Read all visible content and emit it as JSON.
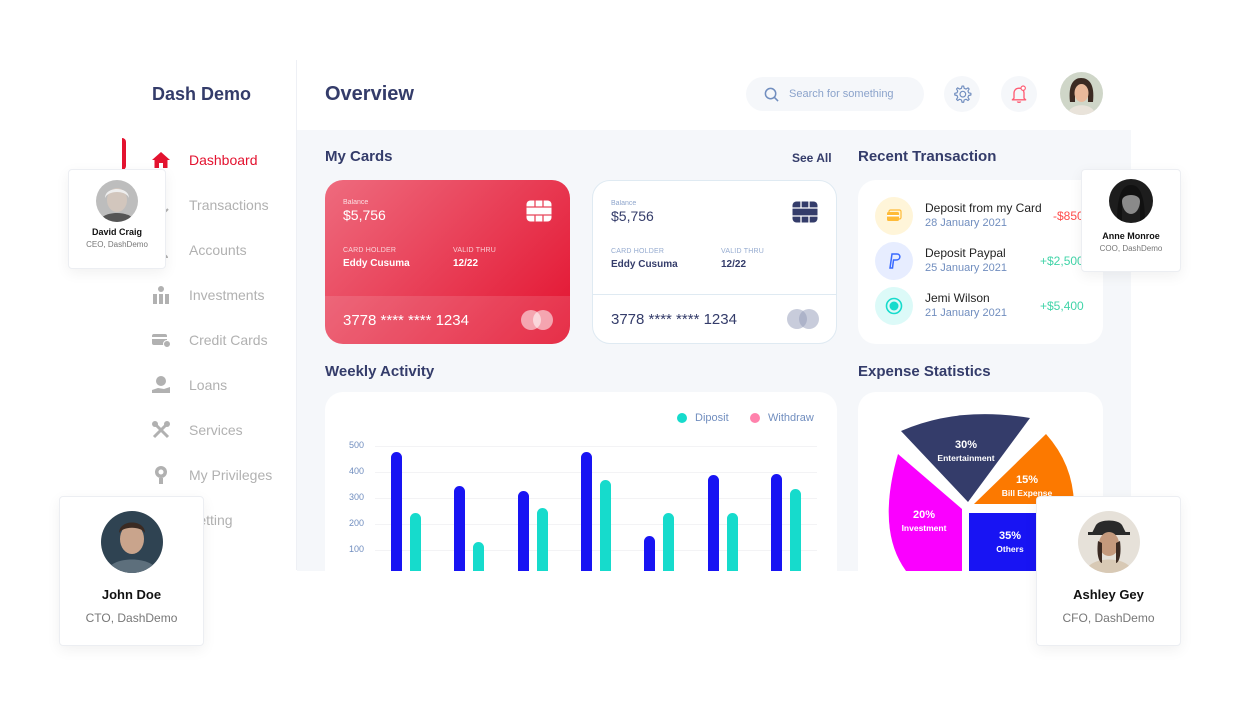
{
  "brand": "Dash Demo",
  "header": {
    "title": "Overview",
    "search_placeholder": "Search for something"
  },
  "sidebar": {
    "items": [
      {
        "label": "Dashboard",
        "icon": "home-icon",
        "active": true
      },
      {
        "label": "Transactions",
        "icon": "transfer-icon"
      },
      {
        "label": "Accounts",
        "icon": "user-icon"
      },
      {
        "label": "Investments",
        "icon": "investment-icon"
      },
      {
        "label": "Credit Cards",
        "icon": "credit-card-icon"
      },
      {
        "label": "Loans",
        "icon": "loan-icon"
      },
      {
        "label": "Services",
        "icon": "services-icon"
      },
      {
        "label": "My Privileges",
        "icon": "privileges-icon"
      },
      {
        "label": "Setting",
        "icon": "settings-icon"
      }
    ]
  },
  "my_cards": {
    "title": "My Cards",
    "see_all": "See All",
    "cards": [
      {
        "balance_label": "Balance",
        "balance": "$5,756",
        "holder_label": "CARD HOLDER",
        "holder": "Eddy Cusuma",
        "valid_label": "VALID THRU",
        "valid": "12/22",
        "number": "3778 **** **** 1234"
      },
      {
        "balance_label": "Balance",
        "balance": "$5,756",
        "holder_label": "CARD HOLDER",
        "holder": "Eddy Cusuma",
        "valid_label": "VALID THRU",
        "valid": "12/22",
        "number": "3778 **** **** 1234"
      }
    ]
  },
  "recent_transaction": {
    "title": "Recent Transaction",
    "items": [
      {
        "name": "Deposit from my Card",
        "date": "28 January 2021",
        "amount": "-$850",
        "icon": "card-icon",
        "amount_color": "#FF4B4A"
      },
      {
        "name": "Deposit Paypal",
        "date": "25 January 2021",
        "amount": "+$2,500",
        "icon": "paypal-icon",
        "amount_color": "#41D4A8"
      },
      {
        "name": "Jemi Wilson",
        "date": "21 January 2021",
        "amount": "+$5,400",
        "icon": "coin-icon",
        "amount_color": "#41D4A8"
      }
    ]
  },
  "weekly_activity": {
    "title": "Weekly Activity",
    "legend": {
      "deposit": "Diposit",
      "withdraw": "Withdraw"
    }
  },
  "chart_data": {
    "type": "bar",
    "categories": [
      "",
      "",
      "",
      "",
      "",
      "",
      ""
    ],
    "series": [
      {
        "name": "Withdraw",
        "color": "#1814F3",
        "values": [
          478,
          347,
          326,
          478,
          152,
          389,
          394
        ]
      },
      {
        "name": "Diposit",
        "color": "#16DBCC",
        "values": [
          241,
          131,
          260,
          368,
          241,
          241,
          336
        ]
      }
    ],
    "y_ticks": [
      500,
      400,
      300,
      200,
      100
    ],
    "ylim": [
      0,
      500
    ]
  },
  "expense_statistics": {
    "title": "Expense Statistics",
    "slices": [
      {
        "pct": "30%",
        "label": "Entertainment",
        "color": "#343C6A"
      },
      {
        "pct": "15%",
        "label": "Bill Expense",
        "color": "#FC7900"
      },
      {
        "pct": "35%",
        "label": "Others",
        "color": "#1814F3"
      },
      {
        "pct": "20%",
        "label": "Investment",
        "color": "#FA00FF"
      }
    ]
  },
  "profiles": {
    "david": {
      "name": "David Craig",
      "role": "CEO, DashDemo"
    },
    "anne": {
      "name": "Anne Monroe",
      "role": "COO, DashDemo"
    },
    "john": {
      "name": "John Doe",
      "role": "CTO, DashDemo"
    },
    "ashley": {
      "name": "Ashley Gey",
      "role": "CFO, DashDemo"
    }
  },
  "colors": {
    "accent": "#E3122F",
    "navy": "#343C6A",
    "muted": "#718EBF",
    "panel": "#F5F7FA"
  }
}
